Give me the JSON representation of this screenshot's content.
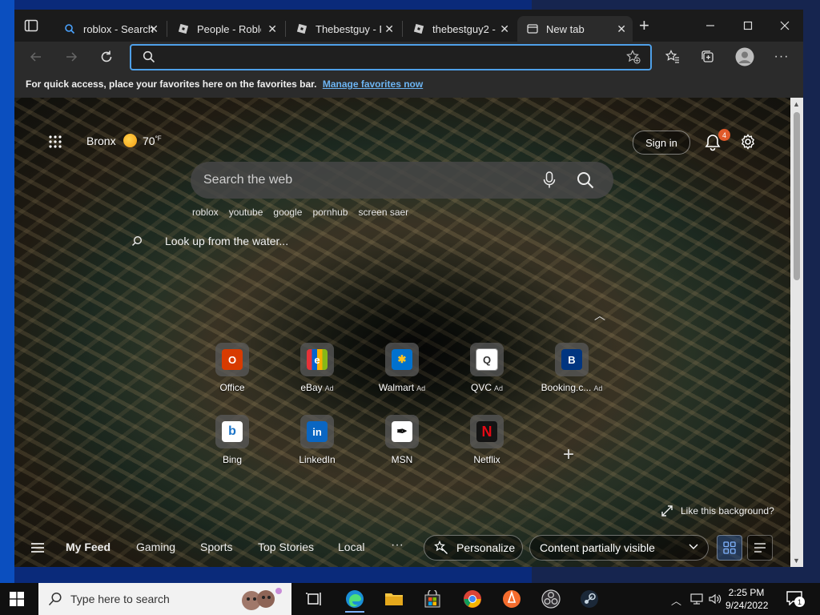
{
  "browser": {
    "tabs": [
      {
        "title": "roblox - Search",
        "icon": "search-icon"
      },
      {
        "title": "People - Roblox",
        "icon": "roblox-icon"
      },
      {
        "title": "Thebestguy - R",
        "icon": "roblox-icon"
      },
      {
        "title": "thebestguy2 -",
        "icon": "roblox-icon"
      },
      {
        "title": "New tab",
        "icon": "newtab-icon",
        "active": true
      }
    ],
    "address": {
      "value": "",
      "placeholder": ""
    },
    "favbar": {
      "message": "For quick access, place your favorites here on the favorites bar.",
      "link": "Manage favorites now"
    }
  },
  "newtab": {
    "location": "Bronx",
    "temperature": "70",
    "temperature_unit": "°F",
    "signin": "Sign in",
    "notification_count": "4",
    "search_placeholder": "Search the web",
    "trending": [
      "roblox",
      "youtube",
      "google",
      "pornhub",
      "screen saer"
    ],
    "lookup": "Look up from the water...",
    "tiles": [
      {
        "label": "Office",
        "ad": "",
        "glyph": "O",
        "color": "#d83b01"
      },
      {
        "label": "eBay",
        "ad": "Ad",
        "glyph": "e",
        "color": "#e53238"
      },
      {
        "label": "Walmart",
        "ad": "Ad",
        "glyph": "✱",
        "color": "#0071ce"
      },
      {
        "label": "QVC",
        "ad": "Ad",
        "glyph": "Q",
        "color": "#ffffff"
      },
      {
        "label": "Booking.c...",
        "ad": "Ad",
        "glyph": "B",
        "color": "#003580"
      },
      {
        "label": "Bing",
        "ad": "",
        "glyph": "b",
        "color": "#ffffff"
      },
      {
        "label": "LinkedIn",
        "ad": "",
        "glyph": "in",
        "color": "#0a66c2"
      },
      {
        "label": "MSN",
        "ad": "",
        "glyph": "✒",
        "color": "#ffffff"
      },
      {
        "label": "Netflix",
        "ad": "",
        "glyph": "N",
        "color": "#e50914"
      }
    ],
    "like_background": "Like this background?",
    "feed_tabs": [
      "My Feed",
      "Gaming",
      "Sports",
      "Top Stories",
      "Local"
    ],
    "personalize": "Personalize",
    "content_visibility": "Content partially visible"
  },
  "taskbar": {
    "search_placeholder": "Type here to search",
    "time": "2:25 PM",
    "date": "9/24/2022",
    "notification_count": "1"
  }
}
